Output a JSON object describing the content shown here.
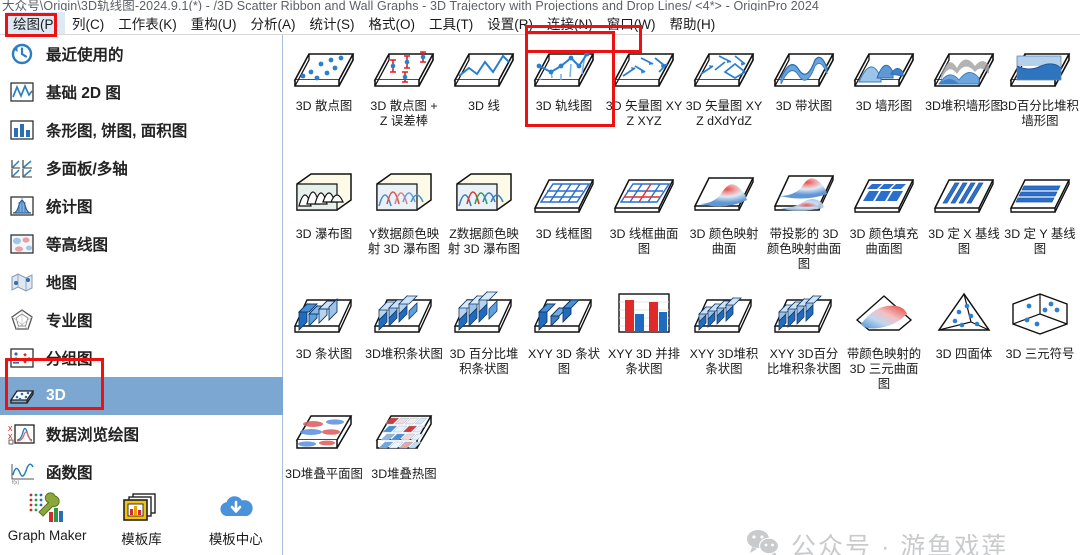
{
  "window": {
    "title": "大众号\\Origin\\3D轨线图-2024.9.1(*) - /3D Scatter Ribbon and Wall Graphs - 3D Trajectory with Projections and Drop Lines/ <4*> - OriginPro 2024"
  },
  "menubar": {
    "items": [
      {
        "label": "绘图(P)",
        "name": "menu-plot",
        "active": true
      },
      {
        "label": "列(C)",
        "name": "menu-column",
        "active": false
      },
      {
        "label": "工作表(K)",
        "name": "menu-worksheet",
        "active": false
      },
      {
        "label": "重构(U)",
        "name": "menu-restructure",
        "active": false
      },
      {
        "label": "分析(A)",
        "name": "menu-analysis",
        "active": false
      },
      {
        "label": "统计(S)",
        "name": "menu-statistics",
        "active": false
      },
      {
        "label": "格式(O)",
        "name": "menu-format",
        "active": false
      },
      {
        "label": "工具(T)",
        "name": "menu-tools",
        "active": false
      },
      {
        "label": "设置(R)",
        "name": "menu-preferences",
        "active": false
      },
      {
        "label": "连接(N)",
        "name": "menu-connect",
        "active": false
      },
      {
        "label": "窗口(W)",
        "name": "menu-window",
        "active": false
      },
      {
        "label": "帮助(H)",
        "name": "menu-help",
        "active": false
      }
    ]
  },
  "sidebar": {
    "items": [
      {
        "label": "最近使用的",
        "icon": "recent-clock-icon",
        "selected": false
      },
      {
        "label": "基础 2D 图",
        "icon": "basic-2d-icon",
        "selected": false
      },
      {
        "label": "条形图, 饼图, 面积图",
        "icon": "bar-pie-area-icon",
        "selected": false
      },
      {
        "label": "多面板/多轴",
        "icon": "multi-panel-icon",
        "selected": false
      },
      {
        "label": "统计图",
        "icon": "statistics-icon",
        "selected": false
      },
      {
        "label": "等高线图",
        "icon": "contour-icon",
        "selected": false
      },
      {
        "label": "地图",
        "icon": "map-icon",
        "selected": false
      },
      {
        "label": "专业图",
        "icon": "specialized-icon",
        "selected": false
      },
      {
        "label": "分组图",
        "icon": "grouped-icon",
        "selected": false
      },
      {
        "label": "3D",
        "icon": "three-d-icon",
        "selected": true
      },
      {
        "label": "数据浏览绘图",
        "icon": "data-explore-icon",
        "selected": false
      },
      {
        "label": "函数图",
        "icon": "function-plot-icon",
        "selected": false
      }
    ],
    "bottom_buttons": [
      {
        "label": "Graph Maker",
        "icon": "graph-maker-icon"
      },
      {
        "label": "模板库",
        "icon": "template-library-icon"
      },
      {
        "label": "模板中心",
        "icon": "template-center-icon"
      }
    ]
  },
  "gallery": {
    "rows": [
      [
        {
          "label": "3D 散点图",
          "icon": "3d-scatter-icon",
          "highlighted": false
        },
        {
          "label": "3D 散点图 + Z 误差棒",
          "icon": "3d-scatter-zerror-icon",
          "highlighted": false
        },
        {
          "label": "3D 线",
          "icon": "3d-line-icon",
          "highlighted": false
        },
        {
          "label": "3D 轨线图",
          "icon": "3d-trajectory-icon",
          "highlighted": true
        },
        {
          "label": "3D 矢量图 XYZ XYZ",
          "icon": "3d-vector-xyzxyz-icon",
          "highlighted": false
        },
        {
          "label": "3D 矢量图 XYZ dXdYdZ",
          "icon": "3d-vector-dxdydz-icon",
          "highlighted": false
        },
        {
          "label": "3D 带状图",
          "icon": "3d-ribbon-icon",
          "highlighted": false
        },
        {
          "label": "3D 墙形图",
          "icon": "3d-wall-icon",
          "highlighted": false
        },
        {
          "label": "3D堆积墙形图",
          "icon": "3d-stacked-wall-icon",
          "highlighted": false
        },
        {
          "label": "3D百分比堆积墙形图",
          "icon": "3d-percent-stacked-wall-icon",
          "highlighted": false
        }
      ],
      [
        {
          "label": "3D 瀑布图",
          "icon": "3d-waterfall-icon",
          "highlighted": false
        },
        {
          "label": "Y数据颜色映射 3D 瀑布图",
          "icon": "3d-waterfall-y-colormap-icon",
          "highlighted": false
        },
        {
          "label": "Z数据颜色映射 3D 瀑布图",
          "icon": "3d-waterfall-z-colormap-icon",
          "highlighted": false
        },
        {
          "label": "3D 线框图",
          "icon": "3d-wireframe-icon",
          "highlighted": false
        },
        {
          "label": "3D 线框曲面图",
          "icon": "3d-wireframe-surface-icon",
          "highlighted": false
        },
        {
          "label": "3D 颜色映射曲面",
          "icon": "3d-colormap-surface-icon",
          "highlighted": false
        },
        {
          "label": "带投影的 3D 颜色映射曲面图",
          "icon": "3d-colormap-surface-projection-icon",
          "highlighted": false
        },
        {
          "label": "3D 颜色填充曲面图",
          "icon": "3d-color-fill-surface-icon",
          "highlighted": false
        },
        {
          "label": "3D 定 X 基线图",
          "icon": "3d-x-constant-base-icon",
          "highlighted": false
        },
        {
          "label": "3D 定 Y 基线图",
          "icon": "3d-y-constant-base-icon",
          "highlighted": false
        }
      ],
      [
        {
          "label": "3D 条状图",
          "icon": "3d-bars-icon",
          "highlighted": false
        },
        {
          "label": "3D堆积条状图",
          "icon": "3d-stacked-bars-icon",
          "highlighted": false
        },
        {
          "label": "3D 百分比堆积条状图",
          "icon": "3d-percent-stacked-bars-icon",
          "highlighted": false
        },
        {
          "label": "XYY 3D 条状图",
          "icon": "xyy-3d-bars-icon",
          "highlighted": false
        },
        {
          "label": "XYY 3D 并排条状图",
          "icon": "xyy-3d-side-by-side-bars-icon",
          "highlighted": false
        },
        {
          "label": "XYY 3D堆积条状图",
          "icon": "xyy-3d-stacked-bars-icon",
          "highlighted": false
        },
        {
          "label": "XYY 3D百分比堆积条状图",
          "icon": "xyy-3d-percent-stacked-bars-icon",
          "highlighted": false
        },
        {
          "label": "带颜色映射的 3D 三元曲面图",
          "icon": "3d-ternary-colormap-surface-icon",
          "highlighted": false
        },
        {
          "label": "3D 四面体",
          "icon": "3d-tetrahedral-icon",
          "highlighted": false
        },
        {
          "label": "3D 三元符号",
          "icon": "3d-ternary-symbol-icon",
          "highlighted": false
        }
      ],
      [
        {
          "label": "3D堆叠平面图",
          "icon": "3d-stacked-plane-icon",
          "highlighted": false
        },
        {
          "label": "3D堆叠热图",
          "icon": "3d-stacked-heatmap-icon",
          "highlighted": false
        }
      ]
    ]
  },
  "watermark": {
    "text": "公众号 · 游鱼戏莲",
    "icon": "wechat-icon",
    "color": "#c8cacc"
  },
  "annotations": {
    "color": "#ee1111",
    "boxes": [
      {
        "name": "highlight-menu-plot"
      },
      {
        "name": "highlight-window-menu"
      },
      {
        "name": "highlight-sidebar-3d"
      },
      {
        "name": "highlight-3d-trajectory"
      }
    ]
  }
}
